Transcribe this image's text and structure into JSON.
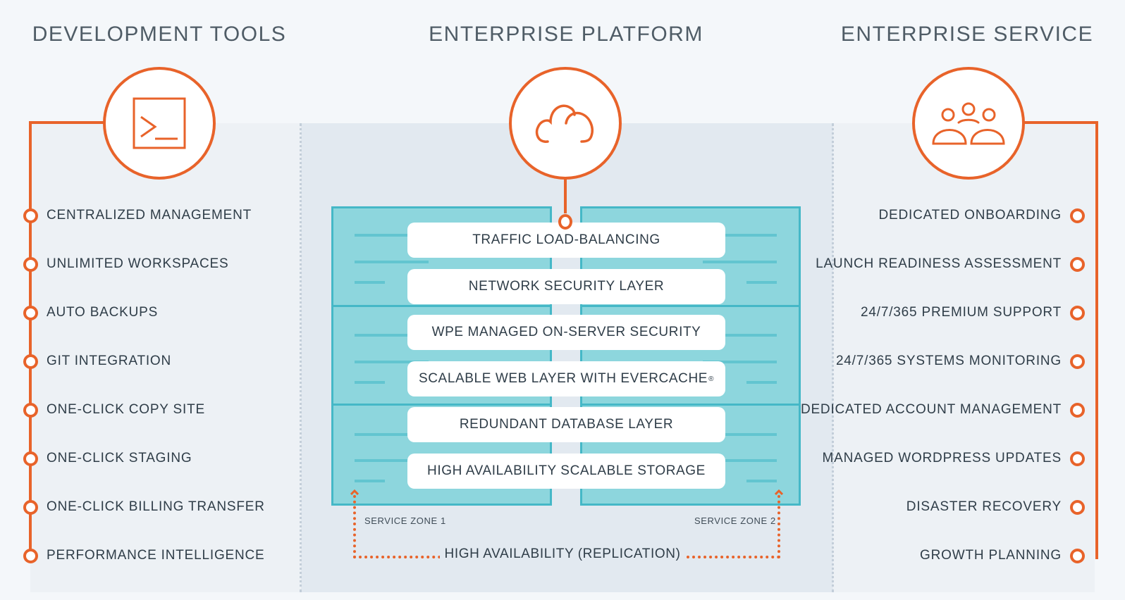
{
  "columns": {
    "development_tools": {
      "title": "DEVELOPMENT TOOLS",
      "icon": "terminal-icon",
      "features": [
        "CENTRALIZED MANAGEMENT",
        "UNLIMITED WORKSPACES",
        "AUTO BACKUPS",
        "GIT INTEGRATION",
        "ONE-CLICK COPY SITE",
        "ONE-CLICK STAGING",
        "ONE-CLICK BILLING TRANSFER",
        "PERFORMANCE INTELLIGENCE"
      ]
    },
    "enterprise_platform": {
      "title": "ENTERPRISE PLATFORM",
      "icon": "cloud-icon",
      "layers": [
        "TRAFFIC LOAD-BALANCING",
        "NETWORK SECURITY LAYER",
        "WPE MANAGED ON-SERVER SECURITY",
        "SCALABLE WEB LAYER WITH EVERCACHE",
        "REDUNDANT DATABASE LAYER",
        "HIGH AVAILABILITY SCALABLE STORAGE"
      ],
      "registered_mark": "®",
      "zones": [
        "SERVICE ZONE 1",
        "SERVICE ZONE 2"
      ],
      "replication_label": "HIGH AVAILABILITY (REPLICATION)"
    },
    "enterprise_service": {
      "title": "ENTERPRISE SERVICE",
      "icon": "users-group-icon",
      "features": [
        "DEDICATED ONBOARDING",
        "LAUNCH READINESS ASSESSMENT",
        "24/7/365 PREMIUM SUPPORT",
        "24/7/365 SYSTEMS MONITORING",
        "DEDICATED ACCOUNT MANAGEMENT",
        "MANAGED WORDPRESS UPDATES",
        "DISASTER RECOVERY",
        "GROWTH PLANNING"
      ]
    }
  },
  "colors": {
    "accent": "#e8632a",
    "server_fill": "#8dd6dd",
    "server_border": "#45b8c7",
    "panel_mid": "#e2e9f0",
    "panel_side": "#edf1f5",
    "background": "#f4f7fa",
    "text": "#2f3d48"
  }
}
